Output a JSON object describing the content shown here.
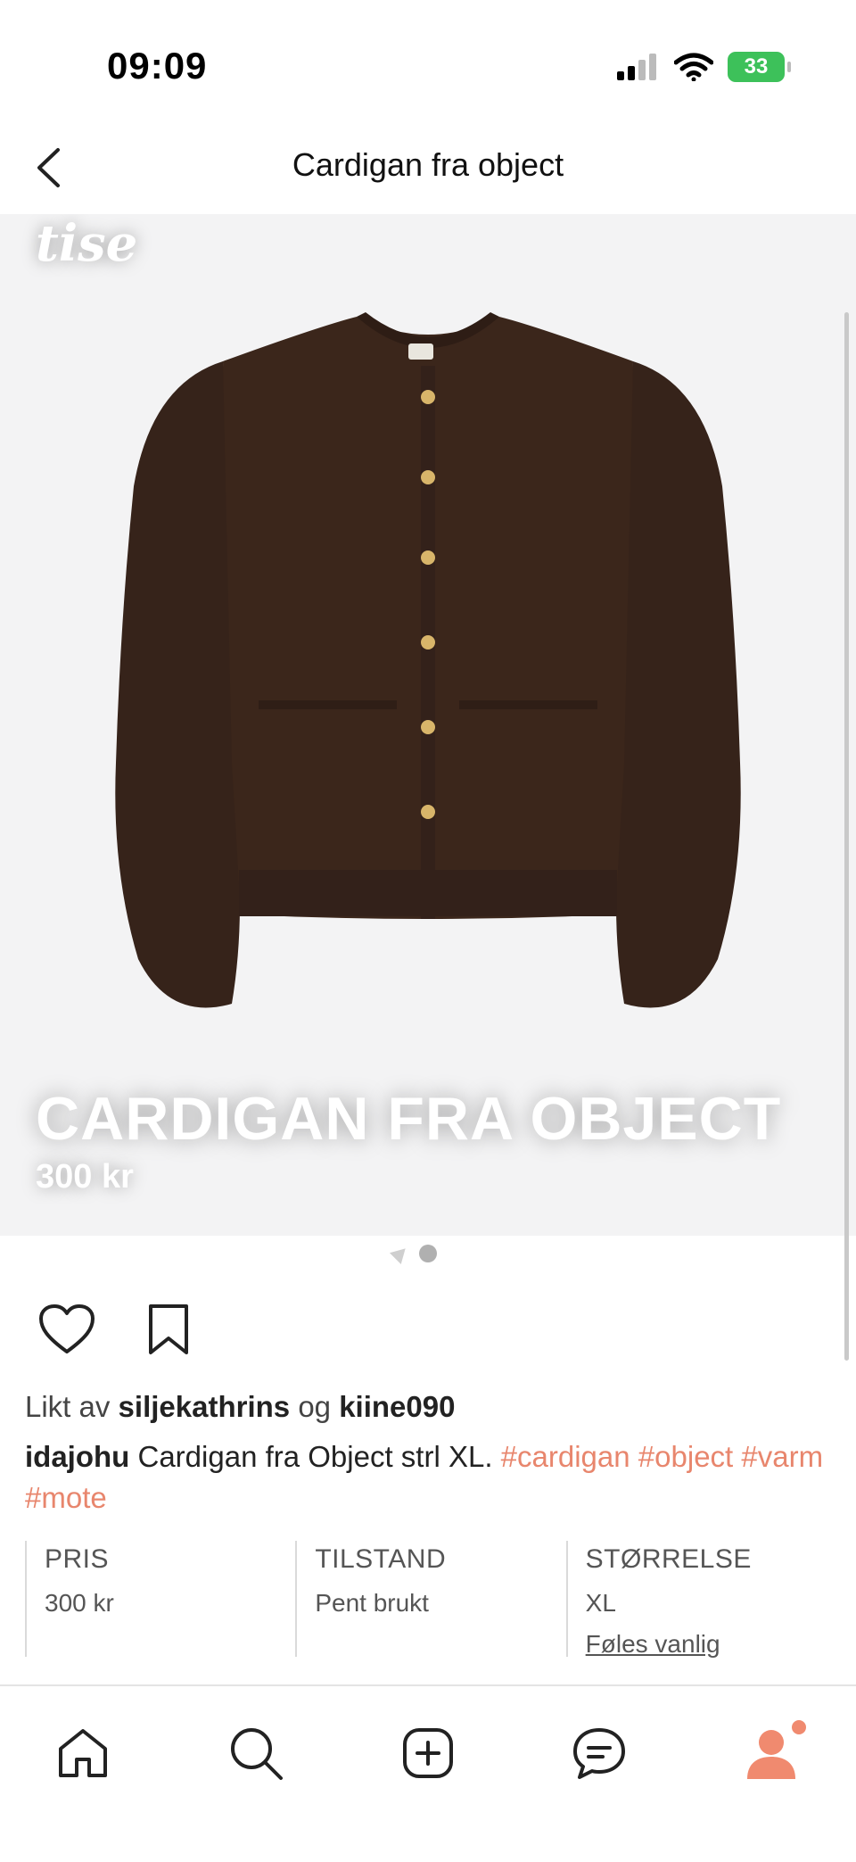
{
  "status_bar": {
    "time": "09:09",
    "battery": "33"
  },
  "header": {
    "title": "Cardigan fra object"
  },
  "listing": {
    "brand": "tise",
    "overlay_title": "CARDIGAN FRA OBJECT",
    "overlay_price": "300 kr",
    "likes": {
      "prefix": "Likt av",
      "user1": "siljekathrins",
      "conjunction": "og",
      "user2": "kiine090"
    },
    "caption": {
      "user": "idajohu",
      "text": "Cardigan fra Object strl XL.",
      "hashtags": [
        "#cardigan",
        "#object",
        "#varm",
        "#mote"
      ]
    },
    "info": [
      {
        "label": "PRIS",
        "value": "300 kr"
      },
      {
        "label": "TILSTAND",
        "value": "Pent brukt"
      },
      {
        "label": "STØRRELSE",
        "value": "XL",
        "link": "Føles vanlig"
      }
    ]
  },
  "tab_bar": {
    "items": [
      {
        "icon": "home-icon"
      },
      {
        "icon": "search-icon"
      },
      {
        "icon": "add-listing-icon"
      },
      {
        "icon": "messages-icon"
      },
      {
        "icon": "profile-icon"
      }
    ]
  },
  "colors": {
    "accent": "#e8866d",
    "battery": "#3dc15a",
    "product": "#3b261b"
  }
}
